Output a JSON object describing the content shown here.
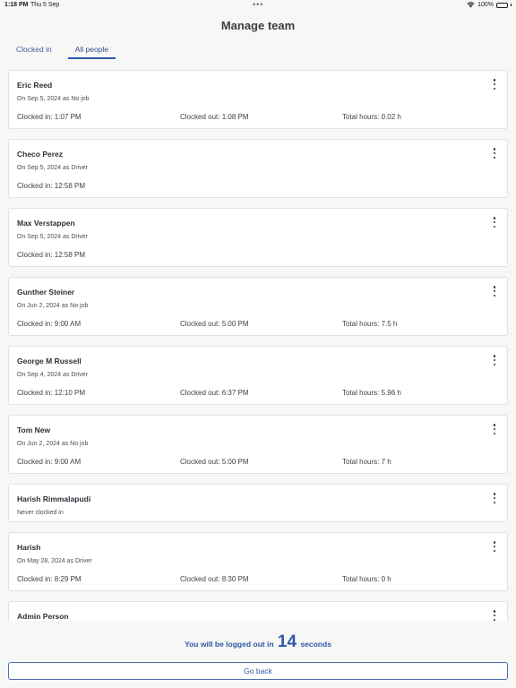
{
  "status": {
    "time": "1:18 PM",
    "date": "Thu 5 Sep",
    "battery": "100%",
    "dots": "•••"
  },
  "header": {
    "title": "Manage team"
  },
  "tabs": [
    {
      "label": "Clocked in",
      "active": false
    },
    {
      "label": "All people",
      "active": true
    }
  ],
  "people": [
    {
      "name": "Eric Reed",
      "sub": "On Sep 5, 2024 as No job",
      "clocked_in": "Clocked in: 1:07 PM",
      "clocked_out": "Clocked out: 1:08 PM",
      "total": "Total hours: 0.02 h"
    },
    {
      "name": "Checo Perez",
      "sub": "On Sep 5, 2024 as Driver",
      "clocked_in": "Clocked in: 12:58 PM",
      "clocked_out": "",
      "total": ""
    },
    {
      "name": "Max Verstappen",
      "sub": "On Sep 5, 2024 as Driver",
      "clocked_in": "Clocked in: 12:58 PM",
      "clocked_out": "",
      "total": ""
    },
    {
      "name": "Gunther Steiner",
      "sub": "On Jun 2, 2024 as No job",
      "clocked_in": "Clocked in: 9:00 AM",
      "clocked_out": "Clocked out: 5:00 PM",
      "total": "Total hours: 7.5 h"
    },
    {
      "name": "George M Russell",
      "sub": "On Sep 4, 2024 as Driver",
      "clocked_in": "Clocked in: 12:10 PM",
      "clocked_out": "Clocked out: 6:37 PM",
      "total": "Total hours: 5.96 h"
    },
    {
      "name": "Tom  New",
      "sub": "On Jun 2, 2024 as No job",
      "clocked_in": "Clocked in: 9:00 AM",
      "clocked_out": "Clocked out: 5:00 PM",
      "total": "Total hours: 7 h"
    },
    {
      "name": "Harish  Rimmalapudi",
      "sub": "Never clocked in",
      "clocked_in": "",
      "clocked_out": "",
      "total": ""
    },
    {
      "name": "Harish",
      "sub": "On May 28, 2024 as Driver",
      "clocked_in": "Clocked in: 8:29 PM",
      "clocked_out": "Clocked out: 8:30 PM",
      "total": "Total hours: 0 h"
    },
    {
      "name": "Admin  Person",
      "sub": "",
      "clocked_in": "",
      "clocked_out": "",
      "total": ""
    }
  ],
  "footer": {
    "logout_prefix": "You will be logged out in",
    "logout_count": "14",
    "logout_suffix": "seconds",
    "go_back_label": "Go back"
  }
}
